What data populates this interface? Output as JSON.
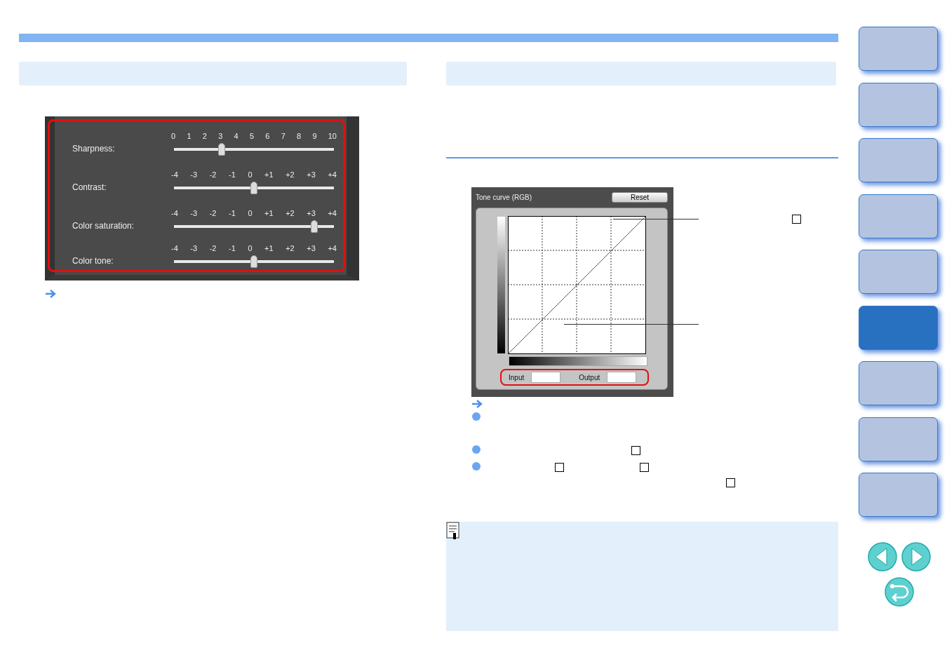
{
  "picture_settings": {
    "sliders": [
      {
        "label": "Sharpness:",
        "ticks": [
          "0",
          "1",
          "2",
          "3",
          "4",
          "5",
          "6",
          "7",
          "8",
          "9",
          "10"
        ],
        "level": 0.3
      },
      {
        "label": "Contrast:",
        "ticks": [
          "-4",
          "-3",
          "-2",
          "-1",
          "0",
          "+1",
          "+2",
          "+3",
          "+4"
        ],
        "level": 0.5
      },
      {
        "label": "Color saturation:",
        "ticks": [
          "-4",
          "-3",
          "-2",
          "-1",
          "0",
          "+1",
          "+2",
          "+3",
          "+4"
        ],
        "level": 0.875
      },
      {
        "label": "Color tone:",
        "ticks": [
          "-4",
          "-3",
          "-2",
          "-1",
          "0",
          "+1",
          "+2",
          "+3",
          "+4"
        ],
        "level": 0.5
      }
    ]
  },
  "tone_curve": {
    "title": "Tone curve (RGB)",
    "reset_button": "Reset",
    "input_label": "Input",
    "output_label": "Output"
  },
  "side_tabs": [
    {
      "selected": false
    },
    {
      "selected": false
    },
    {
      "selected": false
    },
    {
      "selected": false
    },
    {
      "selected": false
    },
    {
      "selected": true
    },
    {
      "selected": false
    },
    {
      "selected": false
    },
    {
      "selected": false
    }
  ]
}
